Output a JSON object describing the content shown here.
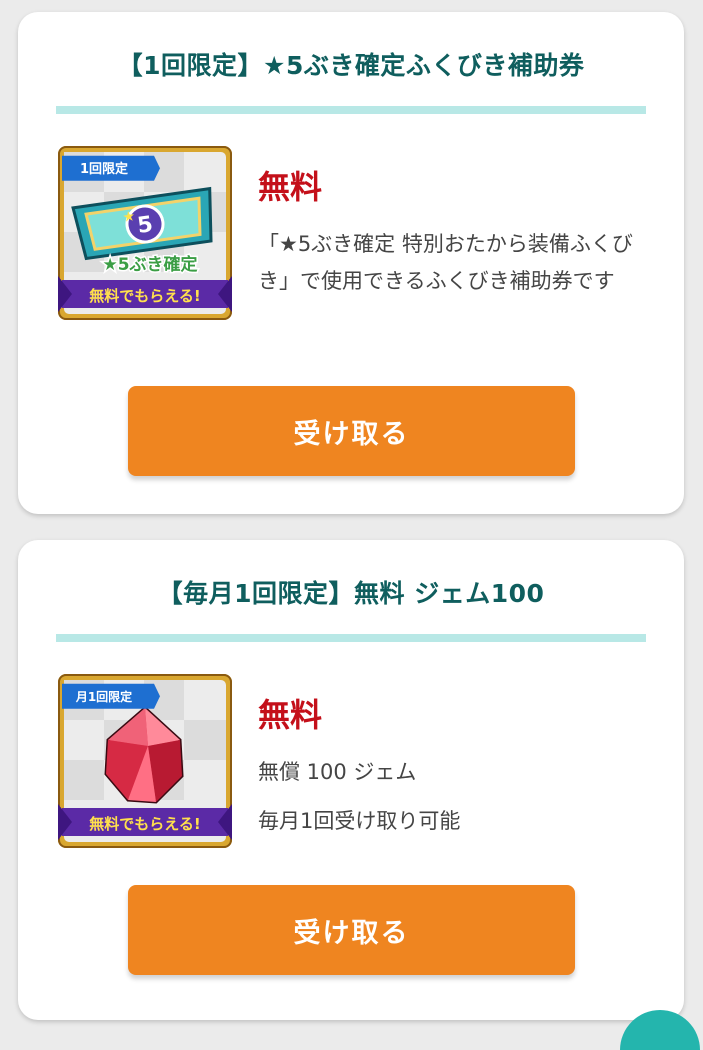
{
  "offers": [
    {
      "title": "【1回限定】★5ぶき確定ふくびき補助券",
      "badge": "1回限定",
      "image_caption": "★5ぶき確定",
      "banner": "無料でもらえる!",
      "price": "無料",
      "description": "「★5ぶき確定 特別おたから装備ふくびき」で使用できるふくびき補助券です",
      "button": "受け取る"
    },
    {
      "title": "【毎月1回限定】無料 ジェム100",
      "badge": "月1回限定",
      "banner": "無料でもらえる!",
      "price": "無料",
      "detail_1": "無償 100 ジェム",
      "detail_2": "毎月1回受け取り可能",
      "button": "受け取る"
    }
  ],
  "colors": {
    "title": "#0f5e5e",
    "divider": "#b8e8e6",
    "price": "#c4101a",
    "button": "#ef8520"
  }
}
